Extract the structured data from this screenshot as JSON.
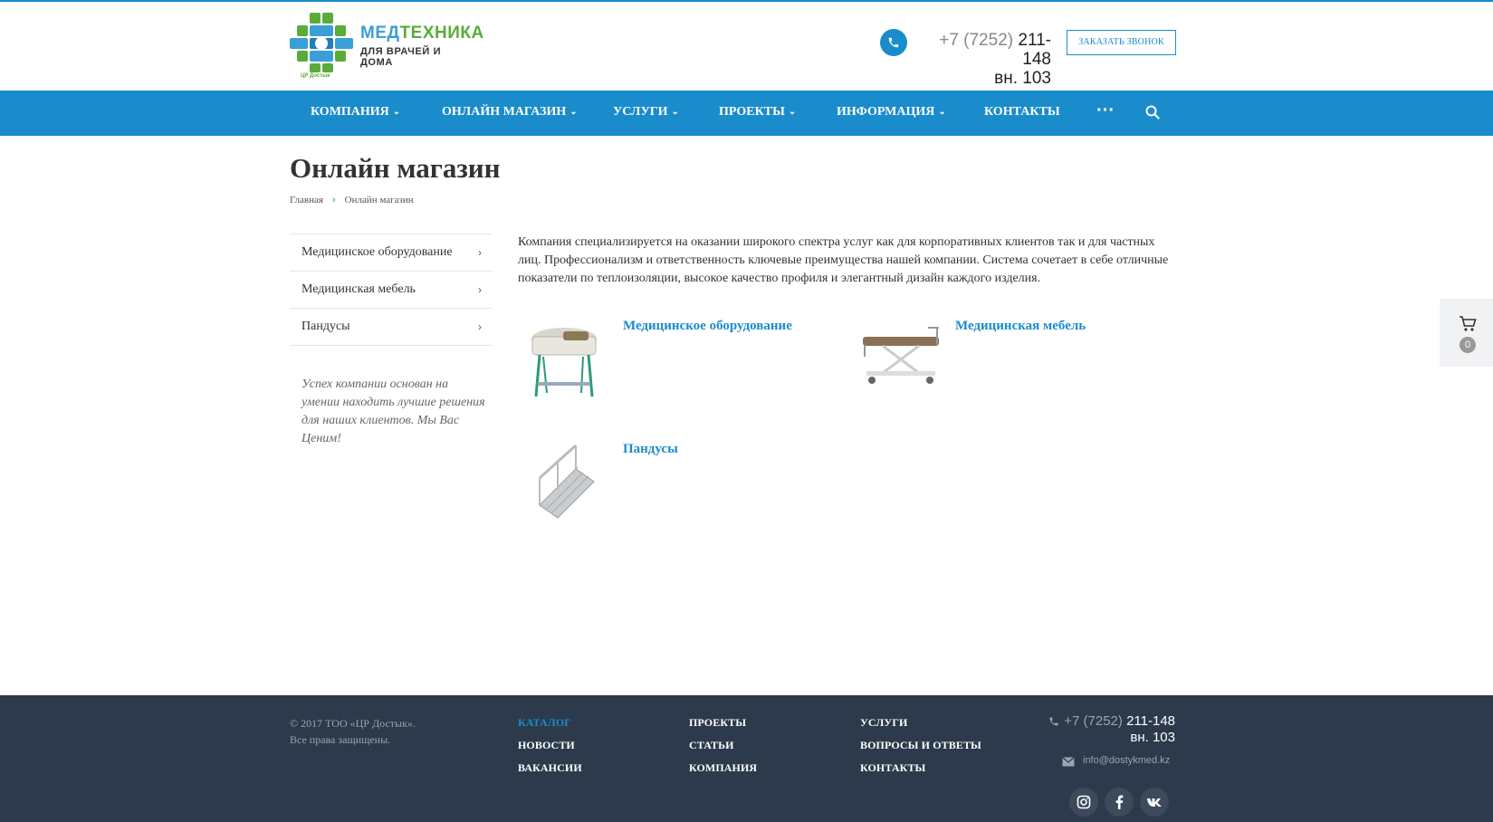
{
  "header": {
    "logo": {
      "title_part1": "МЕД",
      "title_part2": "ТЕХНИКА",
      "tagline": "ДЛЯ ВРАЧЕЙ И ДОМА",
      "sub": "ЦР Достык"
    },
    "phone_code": "+7 (7252)",
    "phone_number": "211-148",
    "phone_ext": "вн. 103",
    "callback_label": "ЗАКАЗАТЬ ЗВОНОК"
  },
  "nav": {
    "items": [
      {
        "label": "КОМПАНИЯ",
        "has_dropdown": true
      },
      {
        "label": "ОНЛАЙН МАГАЗИН",
        "has_dropdown": true
      },
      {
        "label": "УСЛУГИ",
        "has_dropdown": true
      },
      {
        "label": "ПРОЕКТЫ",
        "has_dropdown": true
      },
      {
        "label": "ИНФОРМАЦИЯ",
        "has_dropdown": true
      },
      {
        "label": "КОНТАКТЫ",
        "has_dropdown": false
      }
    ],
    "more_label": "···",
    "search_icon": "search-icon"
  },
  "page": {
    "title": "Онлайн магазин",
    "breadcrumb": [
      "Главная",
      "Онлайн магазин"
    ],
    "intro": "Компания специализируется на оказании широкого спектра услуг как для корпоративных клиентов так и для частных лиц. Профессионализм и ответственность ключевые преимущества нашей компании. Система сочетает в себе отличные показатели по теплоизоляции, высокое качество профиля и элегантный дизайн каждого изделия."
  },
  "sidebar": {
    "items": [
      {
        "label": "Медицинское оборудование"
      },
      {
        "label": "Медицинская мебель"
      },
      {
        "label": "Пандусы"
      }
    ],
    "quote": "Успех компании основан на умении находить лучшие решения для наших клиентов. Мы Вас Ценим!"
  },
  "categories": [
    {
      "title": "Медицинское оборудование",
      "image": "medical-equipment-image"
    },
    {
      "title": "Медицинская мебель",
      "image": "medical-furniture-image"
    },
    {
      "title": "Пандусы",
      "image": "ramp-image"
    }
  ],
  "cart": {
    "count": "0"
  },
  "footer": {
    "copyright_line1": "© 2017 ТОО «ЦР Достык».",
    "copyright_line2": "Все права защищены.",
    "links": [
      {
        "label": "КАТАЛОГ",
        "active": true
      },
      {
        "label": "ПРОЕКТЫ",
        "active": false
      },
      {
        "label": "УСЛУГИ",
        "active": false
      },
      {
        "label": "НОВОСТИ",
        "active": false
      },
      {
        "label": "СТАТЬИ",
        "active": false
      },
      {
        "label": "ВОПРОСЫ И ОТВЕТЫ",
        "active": false
      },
      {
        "label": "ВАКАНСИИ",
        "active": false
      },
      {
        "label": "КОМПАНИЯ",
        "active": false
      },
      {
        "label": "КОНТАКТЫ",
        "active": false
      }
    ],
    "phone_code": "+7 (7252)",
    "phone_number": "211-148",
    "phone_ext": "вн. 103",
    "email": "info@dostykmed.kz",
    "socials": [
      "instagram-icon",
      "facebook-icon",
      "vk-icon"
    ]
  },
  "colors": {
    "accent": "#1a8ccc",
    "footer_bg": "#2c3a4b",
    "logo_green": "#5aab3a"
  }
}
